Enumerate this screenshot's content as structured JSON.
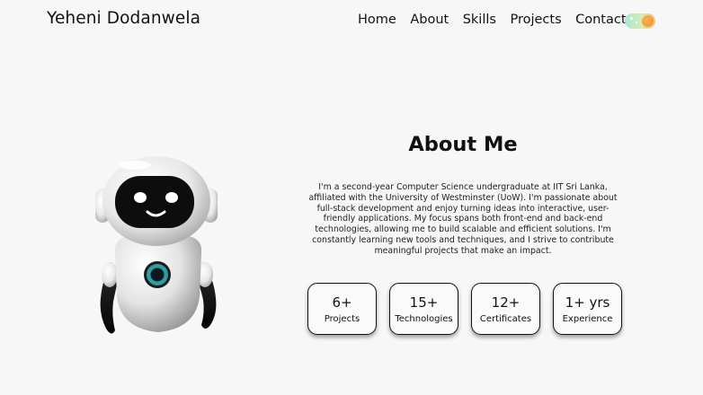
{
  "header": {
    "brand": "Yeheni Dodanwela",
    "nav": [
      {
        "label": "Home"
      },
      {
        "label": "About"
      },
      {
        "label": "Skills"
      },
      {
        "label": "Projects"
      },
      {
        "label": "Contact"
      }
    ],
    "theme_toggle": {
      "icon": "sun-icon",
      "accent": "#f08a24"
    }
  },
  "about": {
    "title": "About Me",
    "description": "I'm a second-year Computer Science undergraduate at IIT Sri Lanka, affiliated with the University of Westminster (UoW). I'm passionate about full-stack development and enjoy turning ideas into interactive, user-friendly applications. My focus spans both front-end and back-end technologies, allowing me to build scalable and efficient solutions. I'm constantly learning new tools and techniques, and I strive to contribute meaningful projects that make an impact.",
    "image": "robot-illustration",
    "stats": [
      {
        "value": "6+",
        "label": "Projects"
      },
      {
        "value": "15+",
        "label": "Technologies"
      },
      {
        "value": "12+",
        "label": "Certificates"
      },
      {
        "value": "1+ yrs",
        "label": "Experience"
      }
    ]
  }
}
